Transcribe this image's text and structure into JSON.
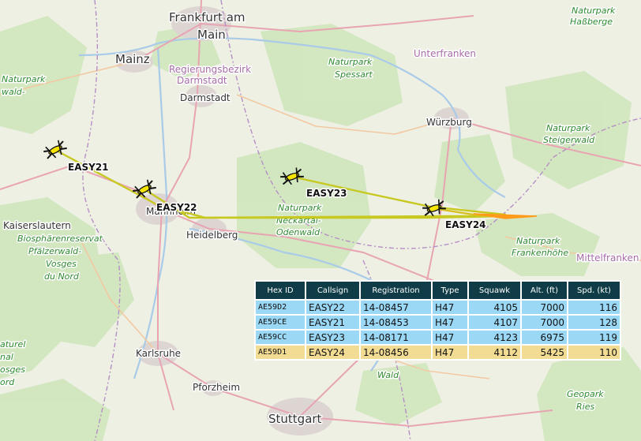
{
  "map": {
    "cities": [
      "Frankfurt am",
      "Main",
      "Mainz",
      "Darmstadt",
      "Würzburg",
      "Heidelberg",
      "Kaiserslautern",
      "Karlsruhe",
      "Pforzheim",
      "Stuttgart",
      "Mannheim"
    ],
    "regions": [
      "Regierungsbezirk",
      "Darmstadt",
      "Unterfranken"
    ],
    "parks": [
      "Naturpark",
      "Haßberge",
      "Naturpark",
      "Spessart",
      "Naturpark",
      "Steigerwald",
      "Naturpark",
      "Neckartal-",
      "Odenwald",
      "Naturpark",
      "Frankenhöhe",
      "Biosphärenreservat",
      "Pfälzerwald-",
      "Vosges",
      "du Nord",
      "Geopark",
      "Ries",
      "Mittelfranken",
      "Wald",
      "Naturpark",
      "wald-",
      "aturel",
      "nal",
      "osges",
      "ord"
    ]
  },
  "aircraft": [
    {
      "callsign": "EASY21",
      "color": "#f4e400"
    },
    {
      "callsign": "EASY22",
      "color": "#f4e400"
    },
    {
      "callsign": "EASY23",
      "color": "#f4e400"
    },
    {
      "callsign": "EASY24",
      "color": "#f4e400"
    }
  ],
  "track_color": "#c7c820",
  "trail_color": "#ff9a1a",
  "table": {
    "headers": [
      "Hex ID",
      "Callsign",
      "Registration",
      "Type",
      "Squawk",
      "Alt. (ft)",
      "Spd. (kt)"
    ],
    "rows": [
      {
        "hex": "AE59D2",
        "callsign": "EASY22",
        "registration": "14-08457",
        "type": "H47",
        "squawk": "4105",
        "alt": "7000",
        "spd": "116",
        "highlight": "blue"
      },
      {
        "hex": "AE59CE",
        "callsign": "EASY21",
        "registration": "14-08453",
        "type": "H47",
        "squawk": "4107",
        "alt": "7000",
        "spd": "128",
        "highlight": "blue"
      },
      {
        "hex": "AE59CC",
        "callsign": "EASY23",
        "registration": "14-08171",
        "type": "H47",
        "squawk": "4123",
        "alt": "6975",
        "spd": "119",
        "highlight": "blue"
      },
      {
        "hex": "AE59D1",
        "callsign": "EASY24",
        "registration": "14-08456",
        "type": "H47",
        "squawk": "4112",
        "alt": "5425",
        "spd": "110",
        "highlight": "yellow"
      }
    ]
  }
}
